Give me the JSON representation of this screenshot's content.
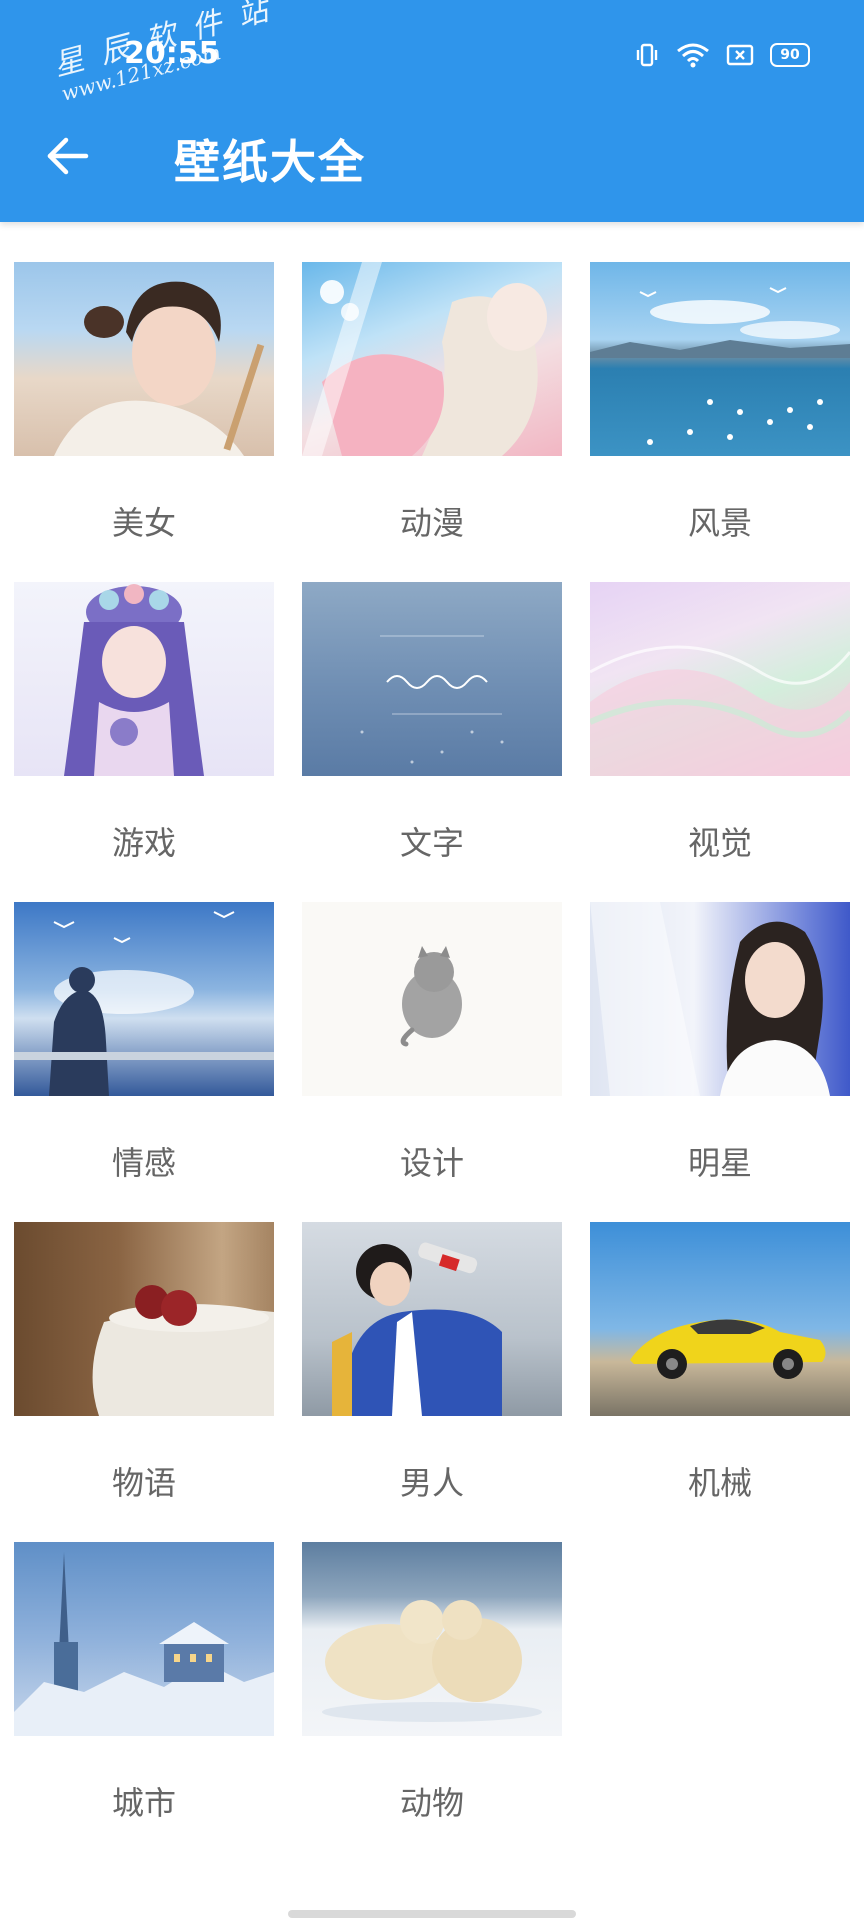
{
  "status_bar": {
    "time": "20:55",
    "watermark_line1": "星 辰 软 件 站",
    "watermark_line2": "www.121xz.com",
    "battery": "90"
  },
  "header": {
    "title": "壁纸大全"
  },
  "categories": [
    {
      "label": "美女"
    },
    {
      "label": "动漫"
    },
    {
      "label": "风景"
    },
    {
      "label": "游戏"
    },
    {
      "label": "文字"
    },
    {
      "label": "视觉"
    },
    {
      "label": "情感"
    },
    {
      "label": "设计"
    },
    {
      "label": "明星"
    },
    {
      "label": "物语"
    },
    {
      "label": "男人"
    },
    {
      "label": "机械"
    },
    {
      "label": "城市"
    },
    {
      "label": "动物"
    }
  ],
  "colors": {
    "header_bg": "#2f95eb",
    "label_text": "#666666"
  }
}
